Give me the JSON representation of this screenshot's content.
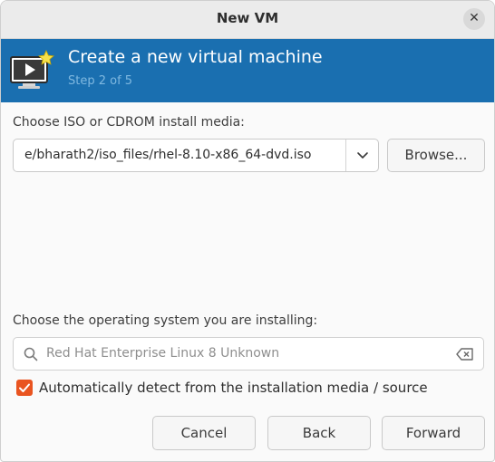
{
  "window": {
    "title": "New VM",
    "close_glyph": "✕"
  },
  "banner": {
    "title": "Create a new virtual machine",
    "step": "Step 2 of 5",
    "icon": "new-vm-icon",
    "background": "#1a6fb0"
  },
  "install_media": {
    "label": "Choose ISO or CDROM install media:",
    "value": "e/bharath2/iso_files/rhel-8.10-x86_64-dvd.iso",
    "browse_label": "Browse..."
  },
  "os": {
    "label": "Choose the operating system you are installing:",
    "search_placeholder": "Red Hat Enterprise Linux 8 Unknown",
    "search_icon": "search-icon",
    "clear_icon": "backspace-icon"
  },
  "autodetect": {
    "label": "Automatically detect from the installation media / source",
    "checked": true,
    "color": "#e95420"
  },
  "footer": {
    "cancel_label": "Cancel",
    "back_label": "Back",
    "forward_label": "Forward"
  }
}
